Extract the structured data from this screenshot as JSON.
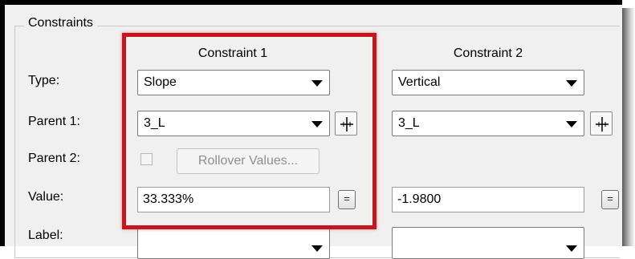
{
  "group": {
    "title": "Constraints"
  },
  "columns": {
    "c1": "Constraint 1",
    "c2": "Constraint 2"
  },
  "labels": {
    "type": "Type:",
    "parent1": "Parent 1:",
    "parent2": "Parent 2:",
    "value": "Value:",
    "label": "Label:"
  },
  "constraint1": {
    "type": "Slope",
    "parent1": "3_L",
    "rollover_label": "Rollover Values...",
    "value": "33.333%",
    "eq_label": "="
  },
  "constraint2": {
    "type": "Vertical",
    "parent1": "3_L",
    "value": "-1.9800",
    "eq_label": "="
  },
  "colors": {
    "highlight": "#c4161c",
    "panel": "#f0f0f0"
  },
  "icons": {
    "pick": "crosshair-pick-icon",
    "dropdown": "chevron-down-icon"
  }
}
